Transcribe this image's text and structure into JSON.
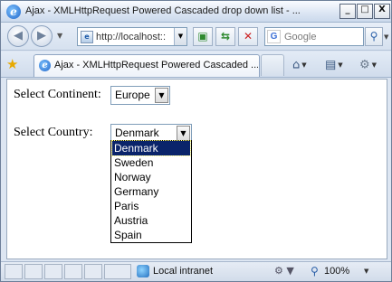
{
  "window": {
    "title": "Ajax - XMLHttpRequest Powered Cascaded drop down list - ...",
    "controls": {
      "minimize": "_",
      "maximize": "□",
      "close": "X"
    }
  },
  "navbar": {
    "address": "http://localhost::",
    "search_placeholder": "Google",
    "search_engine_letter": "G"
  },
  "tab": {
    "label": "Ajax - XMLHttpRequest Powered Cascaded ..."
  },
  "page": {
    "continent_label": "Select Continent:",
    "continent_value": "Europe",
    "country_label": "Select Country:",
    "country_value": "Denmark",
    "country_options": [
      "Denmark",
      "Sweden",
      "Norway",
      "Germany",
      "Paris",
      "Austria",
      "Spain"
    ],
    "selected_index": 0
  },
  "status": {
    "zone": "Local intranet",
    "zoom": "100%"
  },
  "icons": {
    "back": "back-arrow-icon",
    "forward": "forward-arrow-icon",
    "refresh": "refresh-icon",
    "stop": "stop-icon",
    "search": "magnifier-icon",
    "favorites": "star-icon",
    "home": "home-icon",
    "print": "printer-icon",
    "tools": "gear-icon"
  },
  "colors": {
    "selection": "#0a246a",
    "title_bar": "#dbe5f3",
    "favorites_star": "#e7a900"
  }
}
